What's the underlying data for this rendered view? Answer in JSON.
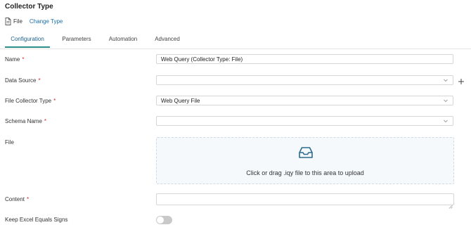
{
  "section_title": "Collector Type",
  "type_row": {
    "file_label": "File",
    "change_type_label": "Change Type"
  },
  "tabs": [
    {
      "label": "Configuration",
      "active": true
    },
    {
      "label": "Parameters",
      "active": false
    },
    {
      "label": "Automation",
      "active": false
    },
    {
      "label": "Advanced",
      "active": false
    }
  ],
  "form": {
    "name": {
      "label": "Name",
      "required": "*",
      "value": "Web Query (Collector Type: File)"
    },
    "data_source": {
      "label": "Data Source",
      "required": "*",
      "value": ""
    },
    "file_collector_type": {
      "label": "File Collector Type",
      "required": "*",
      "value": "Web Query File"
    },
    "schema_name": {
      "label": "Schema Name",
      "required": "*",
      "value": ""
    },
    "file": {
      "label": "File",
      "upload_text": "Click or drag .iqy file to this area to upload"
    },
    "content": {
      "label": "Content",
      "required": "*",
      "value": ""
    },
    "keep_excel_equals": {
      "label": "Keep Excel Equals Signs",
      "enabled": false
    }
  },
  "colors": {
    "accent_teal": "#2a8f8a",
    "link_blue": "#1a6fa8",
    "required_red": "#d12b2b",
    "upload_icon": "#2b6a8f"
  },
  "icons": [
    "file-icon",
    "plus-icon",
    "chevron-down-icon",
    "inbox-icon",
    "resize-grip-icon"
  ]
}
